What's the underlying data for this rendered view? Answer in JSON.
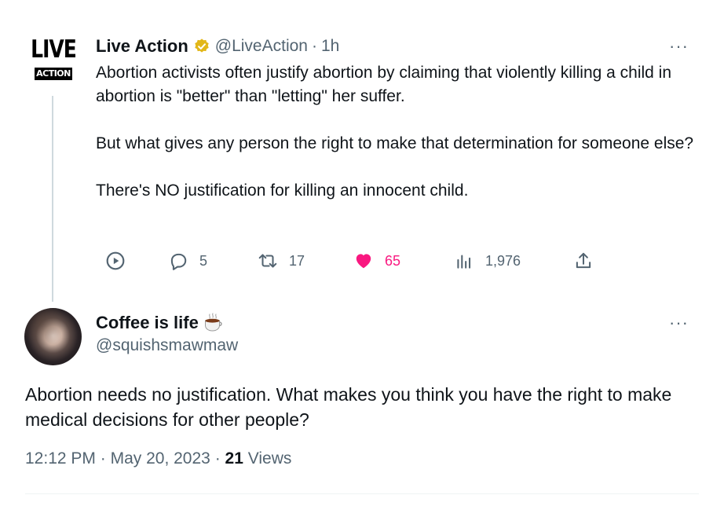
{
  "tweet1": {
    "logo_line1": "LIVE",
    "logo_line2": "ACTION",
    "author_name": "Live Action",
    "handle": "@LiveAction",
    "separator": "·",
    "time": "1h",
    "more": "···",
    "paragraphs": [
      "Abortion activists often justify abortion by claiming that violently killing a child in abortion is \"better\" than \"letting\" her suffer.",
      "But what gives any person the right to make that determination for someone else?",
      "There's NO justification for killing an innocent child."
    ],
    "actions": {
      "replies": "5",
      "retweets": "17",
      "likes": "65",
      "views": "1,976"
    },
    "icons": {
      "play": "play-circle-icon",
      "reply": "reply-icon",
      "retweet": "retweet-icon",
      "like": "heart-filled-icon",
      "views": "views-bar-icon",
      "share": "share-icon",
      "verified": "verified-gold-badge-icon"
    },
    "colors": {
      "like": "#f91880",
      "verified": "#e2b719",
      "muted": "#536471"
    }
  },
  "tweet2": {
    "author_name": "Coffee is life",
    "handle": "@squishsmawmaw",
    "more": "···",
    "text": "Abortion needs no justification. What makes you think you have the right to make medical decisions for other people?",
    "time": "12:12 PM",
    "date": "May 20, 2023",
    "separator": "·",
    "views_count": "21",
    "views_label": "Views",
    "icons": {
      "name_emoji": "coffee-cup-icon"
    }
  }
}
